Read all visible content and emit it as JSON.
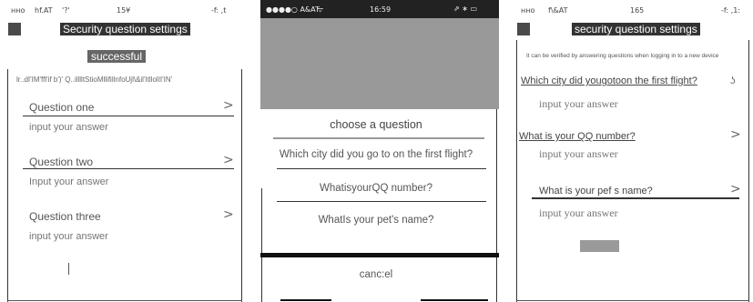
{
  "screen1": {
    "status": {
      "carrier": "нно",
      "network": "hf.AT",
      "signal": "'?'",
      "time": "15¥",
      "battery": "-f: ,t"
    },
    "title": "Security question settings",
    "toast": "successful",
    "hint": "lr..dI'IM'ffl'if b')' Q..illlltStioMllifillnfoUjl\\&il'ItllolII'IN'",
    "questions": [
      {
        "label": "Question one",
        "placeholder": "input your answer"
      },
      {
        "label": "Question two",
        "placeholder": "Input your answer"
      },
      {
        "label": "Question three",
        "placeholder": "input your answer"
      }
    ],
    "chevron": ">"
  },
  "screen2": {
    "status": {
      "carrier": "●●●●○ A&AT",
      "wifi": "ᯤ",
      "time": "16:59",
      "indicators": "⇗ ∗ ▭"
    },
    "sheet_title": "choose a question",
    "options": [
      "Which city did you go to on the first flight?",
      "WhatisyourQQ number?",
      "WhatIs your pet's name?"
    ],
    "cancel": "canc:el"
  },
  "screen3": {
    "status": {
      "carrier": "нно",
      "network": "f\\&AT",
      "time": "165",
      "battery": "-f: ,1:"
    },
    "title": "security question settings",
    "hint": "It can be verified by answering questions when logging in to a new device",
    "questions": [
      {
        "label": "Which city did yougotoon the first flight?",
        "placeholder": "input your answer"
      },
      {
        "label": "What is your QQ number?",
        "placeholder": "input your answer"
      },
      {
        "label": "What is your pef  s name?",
        "placeholder": "input your answer"
      }
    ],
    "chevron": ">",
    "mark": "ʖ"
  },
  "colors": {
    "dark": "#333333",
    "gray_overlay": "#999999",
    "sheet_bg": "#ffffff",
    "button_gray": "#9a9a9a"
  }
}
